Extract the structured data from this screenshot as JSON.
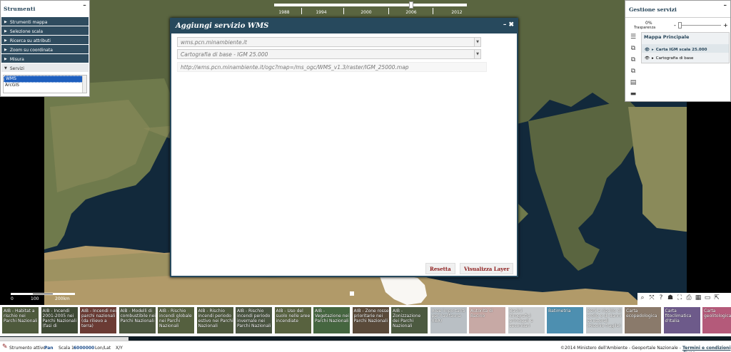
{
  "timeline": {
    "years": [
      "1988",
      "1994",
      "2000",
      "2006",
      "2012"
    ],
    "selected_year": "2006"
  },
  "tools_panel": {
    "title": "Strumenti",
    "items": [
      {
        "label": "Strumenti mappa"
      },
      {
        "label": "Selezione scala"
      },
      {
        "label": "Ricerca su attributi"
      },
      {
        "label": "Zoom su coordinata"
      },
      {
        "label": "Misura"
      }
    ],
    "services_header": "Servizi",
    "services_options": [
      "WMS",
      "ArcGIS"
    ],
    "services_selected": "WMS"
  },
  "wms_dialog": {
    "title": "Aggiungi servizio WMS",
    "server_value": "wms.pcn.minambiente.it",
    "service_value": "Cartografia di base - IGM 25.000",
    "url_value": "http://wms.pcn.minambiente.it/ogc?map=/ms_ogc/WMS_v1.3/raster/IGM_25000.map",
    "reset_label": "Resetta",
    "view_label": "Visualizza Layer"
  },
  "services_panel": {
    "title": "Gestione servizi",
    "transparency_value": "0%",
    "transparency_label": "Trasparenza",
    "transparency_level": 0,
    "map_title": "Mappa Principale",
    "layers": [
      {
        "label": "Carta IGM scala 25.000",
        "active": true
      },
      {
        "label": "Cartografia di base",
        "active": false
      }
    ]
  },
  "scalebar": {
    "labels": [
      "0",
      "100",
      "200km"
    ]
  },
  "thumbnails": [
    {
      "label": "AIB - Habitat a rischio nei Parchi Nazionali",
      "color": "#4e5a3c"
    },
    {
      "label": "AIB - Incendi 2001-2005 nei Parchi Nazionali (fasi di",
      "color": "#3f4a35"
    },
    {
      "label": "AIB - Incendi nei parchi nazionali (da rilievo a terra)",
      "color": "#6b3b34"
    },
    {
      "label": "AIB - Modelli di combustibile nei Parchi Nazionali",
      "color": "#4d5840"
    },
    {
      "label": "AIB - Rischio incendi globale nei Parchi Nazionali",
      "color": "#55603f"
    },
    {
      "label": "AIB - Rischio incendi periodo estivo nei Parchi Nazionali",
      "color": "#4f5a3e"
    },
    {
      "label": "AIB - Rischio incendi periodo invernale nei Parchi Nazionali",
      "color": "#4a5541"
    },
    {
      "label": "AIB - Uso del suolo nelle aree incendiate",
      "color": "#58623f"
    },
    {
      "label": "AIB - Vegetazione nei Parchi Nazionali",
      "color": "#456640"
    },
    {
      "label": "AIB - Zone rosse prioritarie nei Parchi Nazionali",
      "color": "#5a4a3a"
    },
    {
      "label": "AIB - Zonizzazione dei Parchi Nazionali",
      "color": "#4c5a40"
    },
    {
      "label": "Aree importanti per l'avifauna (IBA)",
      "color": "#b9bfc4"
    },
    {
      "label": "Autorità di Bacino",
      "color": "#c7a9a5"
    },
    {
      "label": "Bacini idrografici principali e secondari",
      "color": "#c9ccce"
    },
    {
      "label": "Batimetria",
      "color": "#4d8fb0"
    },
    {
      "label": "Beni a rischio di crollo o di danni strutturali (Rischio fragile)",
      "color": "#c4c9cc"
    },
    {
      "label": "Carta ecopedologica",
      "color": "#8a7a6b"
    },
    {
      "label": "Carta fitoclimatica d'Italia",
      "color": "#6d5a8a"
    },
    {
      "label": "Carta geolitologica",
      "color": "#b45a7a"
    }
  ],
  "status": {
    "tool_label": "Strumento attivo:",
    "tool_value": "Pan",
    "scale_label": "Scala 1:",
    "scale_value": "6000000",
    "coord1": "Lon/Lat",
    "coord2": "X/Y",
    "copyright": "©2014 Ministero dell'Ambiente - Geoportale Nazionale - ",
    "terms": "Termini e condizioni d'uso"
  }
}
